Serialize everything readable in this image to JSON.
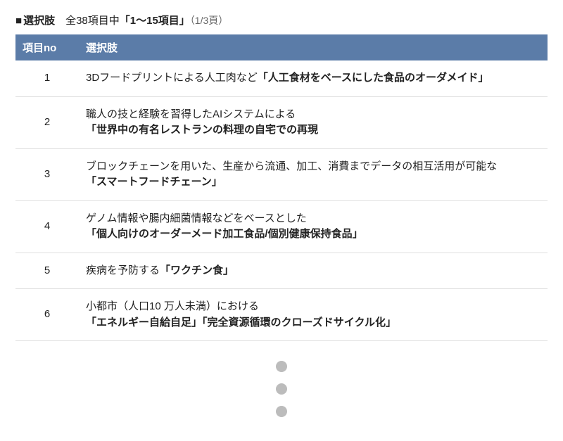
{
  "title": {
    "square": "■",
    "label": "選択肢",
    "range_prefix": "全38項目中",
    "range_bold": "「1～15項目」",
    "page_indicator": "（1/3頁）"
  },
  "header": {
    "col_no": "項目no",
    "col_option": "選択肢"
  },
  "rows": [
    {
      "no": "1",
      "lead": "3Dフードプリントによる人工肉など",
      "bold": "「人工食材をベースにした食品のオーダメイド」",
      "inline": true
    },
    {
      "no": "2",
      "lead": "職人の技と経験を習得したAIシステムによる",
      "bold": "「世界中の有名レストランの料理の自宅での再現",
      "inline": false
    },
    {
      "no": "3",
      "lead": "ブロックチェーンを用いた、生産から流通、加工、消費までデータの相互活用が可能な",
      "bold": "「スマートフードチェーン」",
      "inline": false
    },
    {
      "no": "4",
      "lead": "ゲノム情報や腸内細菌情報などをベースとした",
      "bold": "「個人向けのオーダーメード加工食品/個別健康保持食品」",
      "inline": false
    },
    {
      "no": "5",
      "lead": "疾病を予防する",
      "bold": "「ワクチン食」",
      "inline": true
    },
    {
      "no": "6",
      "lead": "小都市（人口10 万人未満）における",
      "bold": "「エネルギー自給自足」「完全資源循環のクローズドサイクル化」",
      "inline": false
    }
  ],
  "colors": {
    "header_bg": "#5B7CA8",
    "dot": "#bcbcbc"
  }
}
